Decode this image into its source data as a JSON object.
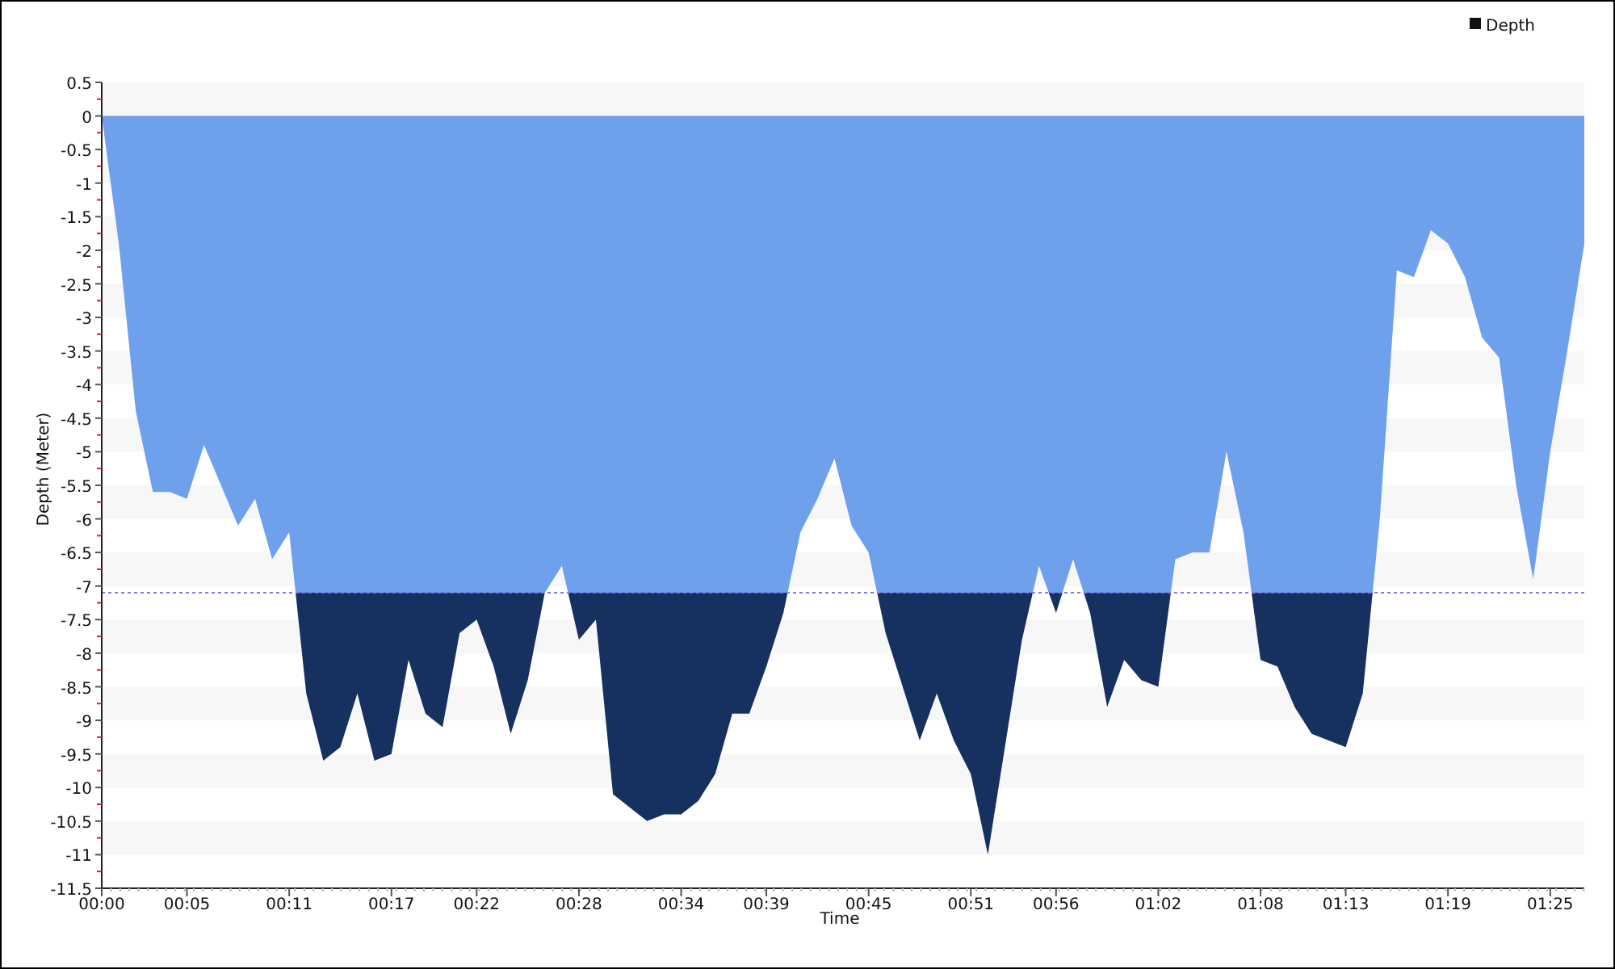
{
  "chart_data": {
    "type": "area",
    "xlabel": "Time",
    "ylabel": "Depth (Meter)",
    "x": [
      0,
      1,
      2,
      3,
      4,
      5,
      6,
      7,
      8,
      9,
      10,
      11,
      12,
      13,
      14,
      15,
      16,
      17,
      18,
      19,
      20,
      21,
      22,
      23,
      24,
      25,
      26,
      27,
      28,
      29,
      30,
      31,
      32,
      33,
      34,
      35,
      36,
      37,
      38,
      39,
      40,
      41,
      42,
      43,
      44,
      45,
      46,
      47,
      48,
      49,
      50,
      51,
      52,
      53,
      54,
      55,
      56,
      57,
      58,
      59,
      60,
      61,
      62,
      63,
      64,
      65,
      66,
      67,
      68,
      69,
      70,
      71,
      72,
      73,
      74,
      75,
      76,
      77,
      78,
      79,
      80,
      81,
      82,
      83,
      84,
      85,
      86,
      87
    ],
    "series": [
      {
        "name": "Depth",
        "color": "#6fa0ec",
        "values": [
          0,
          -1.9,
          -4.4,
          -5.6,
          -5.6,
          -5.7,
          -4.9,
          -5.5,
          -6.1,
          -5.7,
          -6.6,
          -6.2,
          -8.6,
          -9.6,
          -9.4,
          -8.6,
          -9.6,
          -9.5,
          -8.1,
          -8.9,
          -9.1,
          -7.7,
          -7.5,
          -8.2,
          -9.2,
          -8.4,
          -7.1,
          -6.7,
          -7.8,
          -7.5,
          -10.1,
          -10.3,
          -10.5,
          -10.4,
          -10.4,
          -10.2,
          -9.8,
          -8.9,
          -8.9,
          -8.2,
          -7.4,
          -6.2,
          -5.7,
          -5.1,
          -6.1,
          -6.5,
          -7.7,
          -8.5,
          -9.3,
          -8.6,
          -9.3,
          -9.8,
          -11.0,
          -9.4,
          -7.8,
          -6.7,
          -7.4,
          -6.6,
          -7.4,
          -8.8,
          -8.1,
          -8.4,
          -8.5,
          -6.6,
          -6.5,
          -6.5,
          -5.0,
          -6.2,
          -8.1,
          -8.2,
          -8.8,
          -9.2,
          -9.3,
          -9.4,
          -8.6,
          -6.0,
          -2.3,
          -2.4,
          -1.7,
          -1.9,
          -2.4,
          -3.3,
          -3.6,
          -5.5,
          -6.9,
          -5.0,
          -3.5,
          -1.9
        ]
      }
    ],
    "xlim": [
      0,
      87
    ],
    "ylim": [
      -11.5,
      0.5
    ],
    "xticks": [
      {
        "value": 0,
        "label": "00:00"
      },
      {
        "value": 5,
        "label": "00:05"
      },
      {
        "value": 11,
        "label": "00:11"
      },
      {
        "value": 17,
        "label": "00:17"
      },
      {
        "value": 22,
        "label": "00:22"
      },
      {
        "value": 28,
        "label": "00:28"
      },
      {
        "value": 34,
        "label": "00:34"
      },
      {
        "value": 39,
        "label": "00:39"
      },
      {
        "value": 45,
        "label": "00:45"
      },
      {
        "value": 51,
        "label": "00:51"
      },
      {
        "value": 56,
        "label": "00:56"
      },
      {
        "value": 62,
        "label": "01:02"
      },
      {
        "value": 68,
        "label": "01:08"
      },
      {
        "value": 73,
        "label": "01:13"
      },
      {
        "value": 79,
        "label": "01:19"
      },
      {
        "value": 85,
        "label": "01:25"
      }
    ],
    "yticks": [
      0.5,
      0,
      -0.5,
      -1,
      -1.5,
      -2,
      -2.5,
      -3,
      -3.5,
      -4,
      -4.5,
      -5,
      -5.5,
      -6,
      -6.5,
      -7,
      -7.5,
      -8,
      -8.5,
      -9,
      -9.5,
      -10,
      -10.5,
      -11,
      -11.5
    ],
    "ref_lines": [
      {
        "axis": "y",
        "value": -7.1,
        "color": "#7b7bef"
      }
    ]
  }
}
